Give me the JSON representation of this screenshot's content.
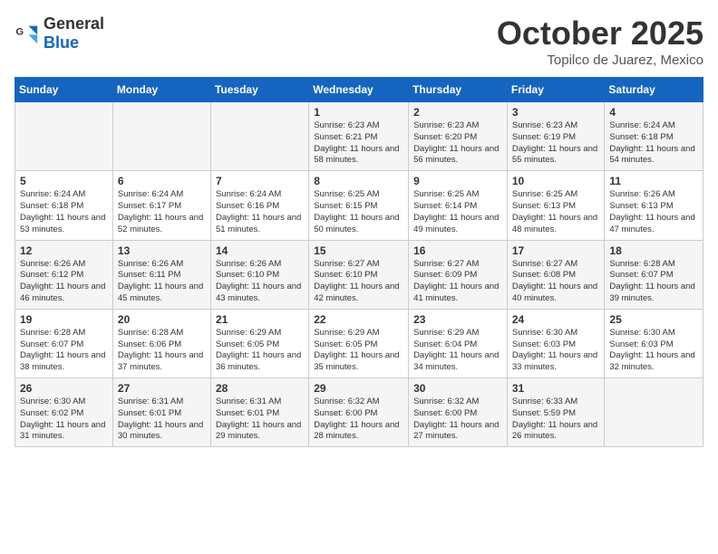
{
  "header": {
    "logo_general": "General",
    "logo_blue": "Blue",
    "month_title": "October 2025",
    "location": "Topilco de Juarez, Mexico"
  },
  "weekdays": [
    "Sunday",
    "Monday",
    "Tuesday",
    "Wednesday",
    "Thursday",
    "Friday",
    "Saturday"
  ],
  "weeks": [
    [
      {
        "day": "",
        "info": ""
      },
      {
        "day": "",
        "info": ""
      },
      {
        "day": "",
        "info": ""
      },
      {
        "day": "1",
        "info": "Sunrise: 6:23 AM\nSunset: 6:21 PM\nDaylight: 11 hours and 58 minutes."
      },
      {
        "day": "2",
        "info": "Sunrise: 6:23 AM\nSunset: 6:20 PM\nDaylight: 11 hours and 56 minutes."
      },
      {
        "day": "3",
        "info": "Sunrise: 6:23 AM\nSunset: 6:19 PM\nDaylight: 11 hours and 55 minutes."
      },
      {
        "day": "4",
        "info": "Sunrise: 6:24 AM\nSunset: 6:18 PM\nDaylight: 11 hours and 54 minutes."
      }
    ],
    [
      {
        "day": "5",
        "info": "Sunrise: 6:24 AM\nSunset: 6:18 PM\nDaylight: 11 hours and 53 minutes."
      },
      {
        "day": "6",
        "info": "Sunrise: 6:24 AM\nSunset: 6:17 PM\nDaylight: 11 hours and 52 minutes."
      },
      {
        "day": "7",
        "info": "Sunrise: 6:24 AM\nSunset: 6:16 PM\nDaylight: 11 hours and 51 minutes."
      },
      {
        "day": "8",
        "info": "Sunrise: 6:25 AM\nSunset: 6:15 PM\nDaylight: 11 hours and 50 minutes."
      },
      {
        "day": "9",
        "info": "Sunrise: 6:25 AM\nSunset: 6:14 PM\nDaylight: 11 hours and 49 minutes."
      },
      {
        "day": "10",
        "info": "Sunrise: 6:25 AM\nSunset: 6:13 PM\nDaylight: 11 hours and 48 minutes."
      },
      {
        "day": "11",
        "info": "Sunrise: 6:26 AM\nSunset: 6:13 PM\nDaylight: 11 hours and 47 minutes."
      }
    ],
    [
      {
        "day": "12",
        "info": "Sunrise: 6:26 AM\nSunset: 6:12 PM\nDaylight: 11 hours and 46 minutes."
      },
      {
        "day": "13",
        "info": "Sunrise: 6:26 AM\nSunset: 6:11 PM\nDaylight: 11 hours and 45 minutes."
      },
      {
        "day": "14",
        "info": "Sunrise: 6:26 AM\nSunset: 6:10 PM\nDaylight: 11 hours and 43 minutes."
      },
      {
        "day": "15",
        "info": "Sunrise: 6:27 AM\nSunset: 6:10 PM\nDaylight: 11 hours and 42 minutes."
      },
      {
        "day": "16",
        "info": "Sunrise: 6:27 AM\nSunset: 6:09 PM\nDaylight: 11 hours and 41 minutes."
      },
      {
        "day": "17",
        "info": "Sunrise: 6:27 AM\nSunset: 6:08 PM\nDaylight: 11 hours and 40 minutes."
      },
      {
        "day": "18",
        "info": "Sunrise: 6:28 AM\nSunset: 6:07 PM\nDaylight: 11 hours and 39 minutes."
      }
    ],
    [
      {
        "day": "19",
        "info": "Sunrise: 6:28 AM\nSunset: 6:07 PM\nDaylight: 11 hours and 38 minutes."
      },
      {
        "day": "20",
        "info": "Sunrise: 6:28 AM\nSunset: 6:06 PM\nDaylight: 11 hours and 37 minutes."
      },
      {
        "day": "21",
        "info": "Sunrise: 6:29 AM\nSunset: 6:05 PM\nDaylight: 11 hours and 36 minutes."
      },
      {
        "day": "22",
        "info": "Sunrise: 6:29 AM\nSunset: 6:05 PM\nDaylight: 11 hours and 35 minutes."
      },
      {
        "day": "23",
        "info": "Sunrise: 6:29 AM\nSunset: 6:04 PM\nDaylight: 11 hours and 34 minutes."
      },
      {
        "day": "24",
        "info": "Sunrise: 6:30 AM\nSunset: 6:03 PM\nDaylight: 11 hours and 33 minutes."
      },
      {
        "day": "25",
        "info": "Sunrise: 6:30 AM\nSunset: 6:03 PM\nDaylight: 11 hours and 32 minutes."
      }
    ],
    [
      {
        "day": "26",
        "info": "Sunrise: 6:30 AM\nSunset: 6:02 PM\nDaylight: 11 hours and 31 minutes."
      },
      {
        "day": "27",
        "info": "Sunrise: 6:31 AM\nSunset: 6:01 PM\nDaylight: 11 hours and 30 minutes."
      },
      {
        "day": "28",
        "info": "Sunrise: 6:31 AM\nSunset: 6:01 PM\nDaylight: 11 hours and 29 minutes."
      },
      {
        "day": "29",
        "info": "Sunrise: 6:32 AM\nSunset: 6:00 PM\nDaylight: 11 hours and 28 minutes."
      },
      {
        "day": "30",
        "info": "Sunrise: 6:32 AM\nSunset: 6:00 PM\nDaylight: 11 hours and 27 minutes."
      },
      {
        "day": "31",
        "info": "Sunrise: 6:33 AM\nSunset: 5:59 PM\nDaylight: 11 hours and 26 minutes."
      },
      {
        "day": "",
        "info": ""
      }
    ]
  ]
}
